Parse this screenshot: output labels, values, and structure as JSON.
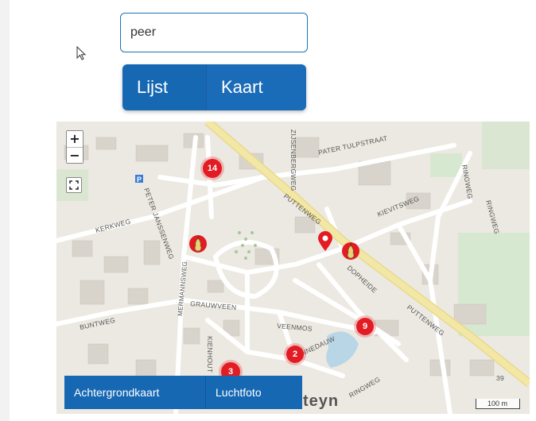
{
  "search": {
    "value": "peer"
  },
  "view_toggle": {
    "list_label": "Lijst",
    "map_label": "Kaart"
  },
  "map": {
    "zoom_in_label": "+",
    "zoom_out_label": "−",
    "clusters": [
      {
        "label": "14"
      },
      {
        "label": "9"
      },
      {
        "label": "2"
      },
      {
        "label": "3"
      }
    ],
    "street_labels": [
      "ZIJSENBERGWEG",
      "PATER TULPSTRAAT",
      "RINGWEG",
      "PETER JANSSENWEG",
      "KERKWEG",
      "PUTTENWEG",
      "KIEVITSWEG",
      "DOPHEIDE",
      "PUTTENWEG",
      "GRAUWVEEN",
      "VEENMOS",
      "BUNTWEG",
      "MERMANNSWEG",
      "KIENHOUT",
      "ZONNEDAUW",
      "RINGWEG",
      "RINGWEG"
    ],
    "place_label": "teyn",
    "elevation_label": "39",
    "scale_label": "100 m",
    "colors": {
      "cluster": "#e31b23",
      "main_road": "#f3e7a6",
      "water": "#b9d6e6",
      "green": "#d6e8cf",
      "button_blue": "#1668b3"
    }
  },
  "layer_switch": {
    "background_label": "Achtergrondkaart",
    "photo_label": "Luchtfoto"
  }
}
